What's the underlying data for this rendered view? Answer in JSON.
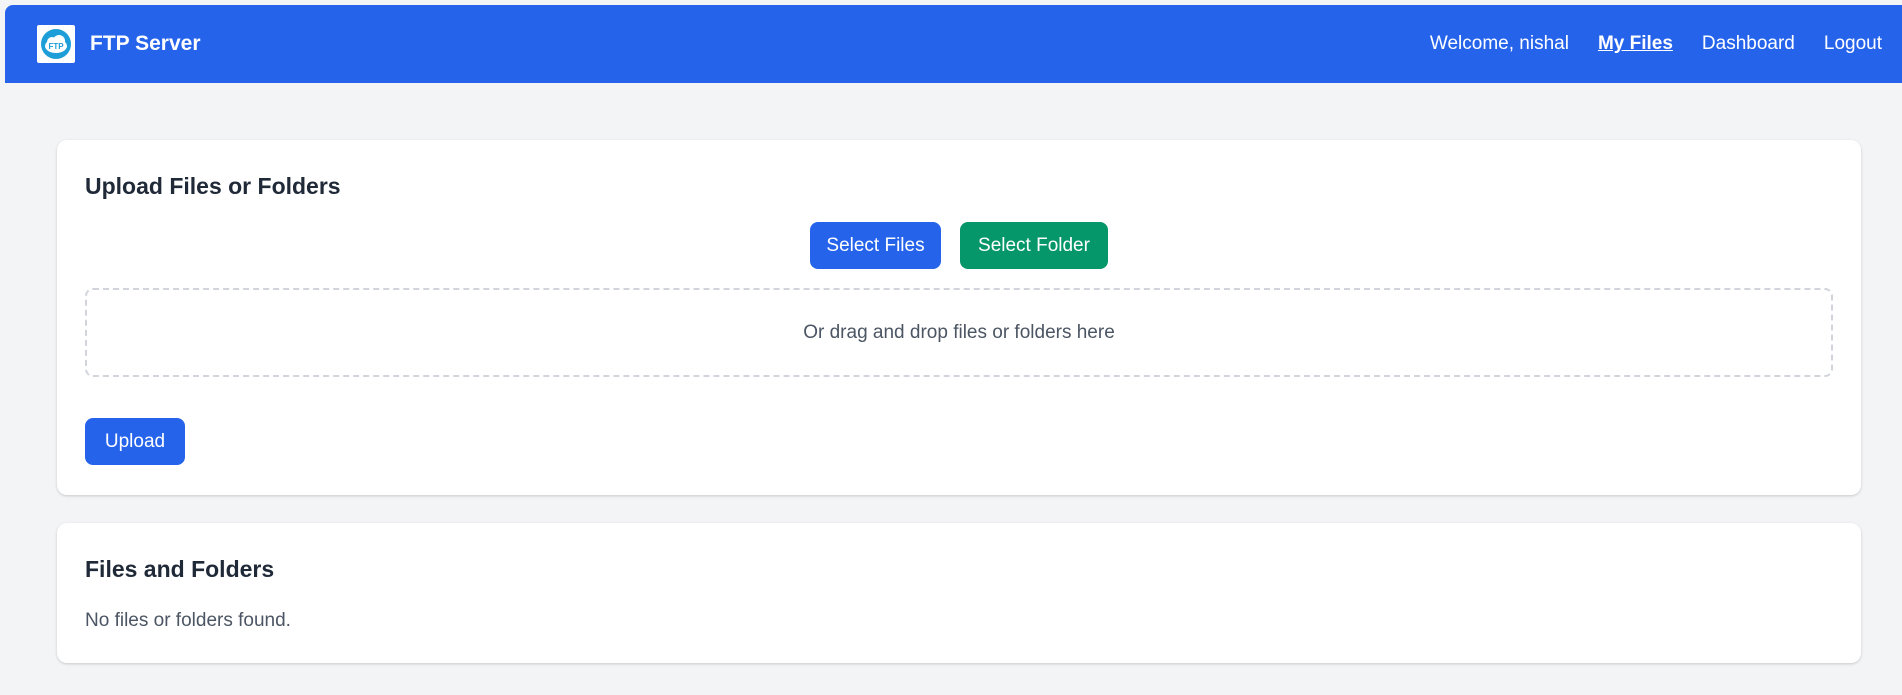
{
  "navbar": {
    "brand_title": "FTP Server",
    "logo_text": "FTP",
    "welcome": "Welcome, nishal",
    "links": [
      "My Files",
      "Dashboard",
      "Logout"
    ],
    "active_link": "My Files",
    "color": "#2563eb"
  },
  "upload": {
    "title": "Upload Files or Folders",
    "select_files_label": "Select Files",
    "select_folder_label": "Select Folder",
    "dropzone_text": "Or drag and drop files or folders here",
    "upload_label": "Upload"
  },
  "files": {
    "title": "Files and Folders",
    "empty_text": "No files or folders found."
  },
  "colors": {
    "primary": "#2563eb",
    "success": "#059669",
    "background": "#f3f4f6"
  }
}
